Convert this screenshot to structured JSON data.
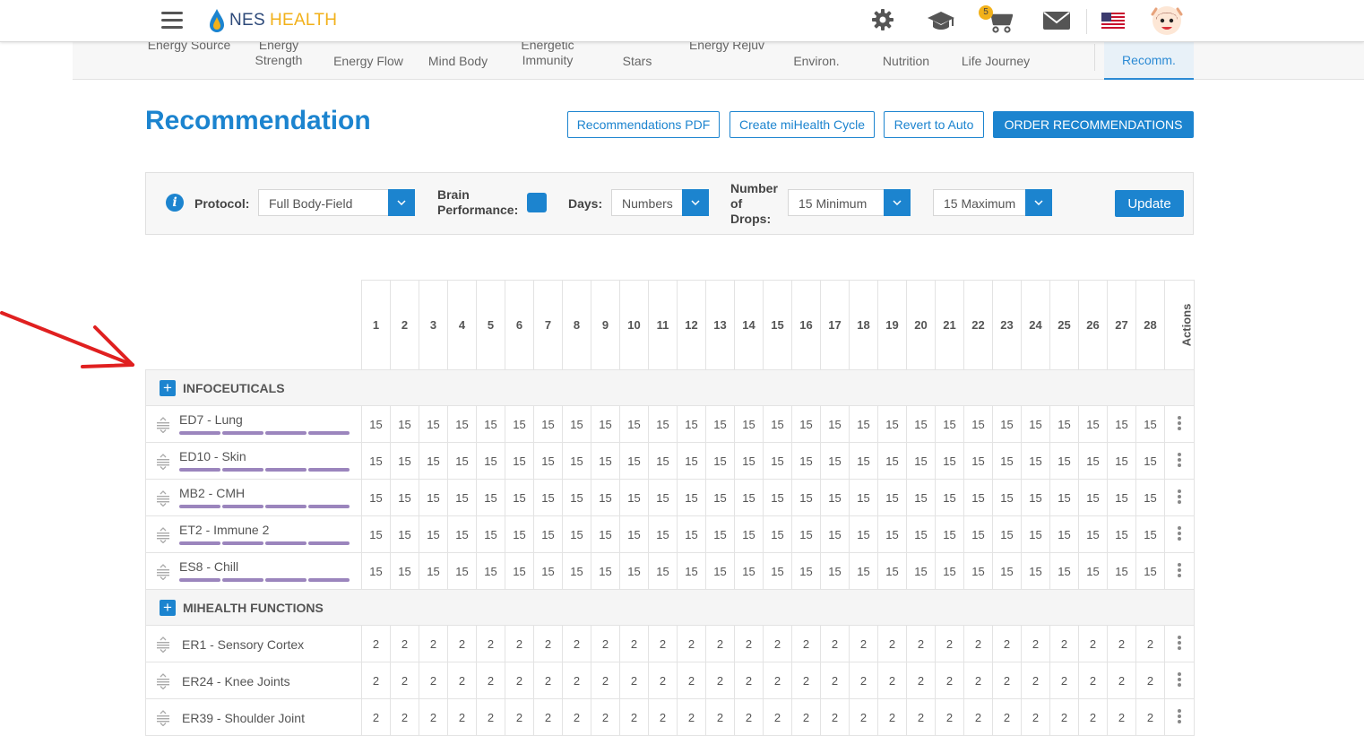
{
  "header": {
    "logo_nes": "NES",
    "logo_health": "HEALTH",
    "cart_count": "5",
    "icons": [
      "menu-icon",
      "gear-icon",
      "graduation-cap-icon",
      "cart-icon",
      "mail-icon",
      "us-flag-icon",
      "avatar"
    ]
  },
  "tabs": [
    {
      "label": "Energy Source"
    },
    {
      "label": "Energy Strength"
    },
    {
      "label": "Energy Flow"
    },
    {
      "label": "Mind Body"
    },
    {
      "label": "Energetic Immunity"
    },
    {
      "label": "Stars"
    },
    {
      "label": "Energy Rejuv"
    },
    {
      "label": "Environ."
    },
    {
      "label": "Nutrition"
    },
    {
      "label": "Life Journey"
    },
    {
      "label": "Recomm.",
      "active": true
    }
  ],
  "page": {
    "title": "Recommendation",
    "buttons": {
      "pdf": "Recommendations PDF",
      "cycle": "Create miHealth Cycle",
      "revert": "Revert to Auto",
      "order": "ORDER RECOMMENDATIONS"
    }
  },
  "filters": {
    "protocol_label": "Protocol:",
    "protocol_value": "Full Body-Field",
    "brain_label_1": "Brain",
    "brain_label_2": "Performance:",
    "days_label": "Days:",
    "days_value": "Numbers",
    "drops_label_1": "Number",
    "drops_label_2": "of",
    "drops_label_3": "Drops:",
    "min_value": "15 Minimum",
    "max_value": "15 Maximum",
    "update_label": "Update"
  },
  "table": {
    "days": [
      "1",
      "2",
      "3",
      "4",
      "5",
      "6",
      "7",
      "8",
      "9",
      "10",
      "11",
      "12",
      "13",
      "14",
      "15",
      "16",
      "17",
      "18",
      "19",
      "20",
      "21",
      "22",
      "23",
      "24",
      "25",
      "26",
      "27",
      "28"
    ],
    "actions_label": "Actions",
    "groups": [
      {
        "label": "INFOCEUTICALS",
        "items": [
          {
            "name": "ED7 - Lung",
            "value": "15",
            "bars": true
          },
          {
            "name": "ED10 - Skin",
            "value": "15",
            "bars": true
          },
          {
            "name": "MB2 - CMH",
            "value": "15",
            "bars": true
          },
          {
            "name": "ET2 - Immune 2",
            "value": "15",
            "bars": true
          },
          {
            "name": "ES8 - Chill",
            "value": "15",
            "bars": true
          }
        ]
      },
      {
        "label": "MIHEALTH FUNCTIONS",
        "items": [
          {
            "name": "ER1 - Sensory Cortex",
            "value": "2",
            "bars": false
          },
          {
            "name": "ER24 - Knee Joints",
            "value": "2",
            "bars": false
          },
          {
            "name": "ER39 - Shoulder Joint",
            "value": "2",
            "bars": false
          }
        ]
      }
    ]
  },
  "colors": {
    "accent": "#1c84cf",
    "bar": "#9b85bd",
    "annotation": "#e02020",
    "logo_gold": "#f2b11a"
  }
}
